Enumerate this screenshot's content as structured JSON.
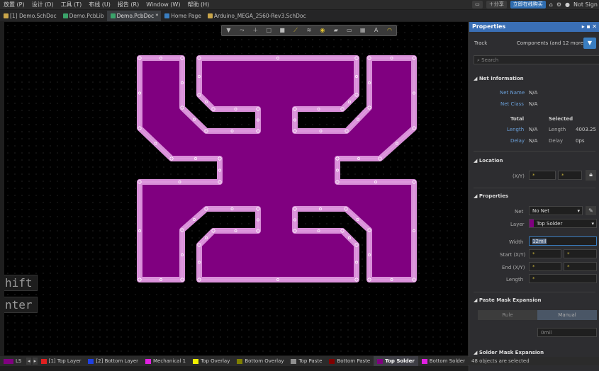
{
  "menu": {
    "items": [
      "放置 (P)",
      "设计 (D)",
      "工具 (T)",
      "布线 (U)",
      "报告 (R)",
      "Window (W)",
      "帮助 (H)"
    ],
    "share_label": "分享",
    "online_buy_label": "立即在线购买",
    "user_label": "Not Sign"
  },
  "tabs": [
    {
      "label": "[1] Demo.SchDoc",
      "icon": "schematic-doc-icon"
    },
    {
      "label": "Demo.PcbLib",
      "icon": "pcb-lib-icon"
    },
    {
      "label": "Demo.PcbDoc *",
      "icon": "pcb-doc-icon"
    },
    {
      "label": "Home Page",
      "icon": "home-icon"
    },
    {
      "label": "Arduino_MEGA_2560-Rev3.SchDoc",
      "icon": "schematic-doc-icon"
    }
  ],
  "canvas": {
    "overlay_hint_1": "hift",
    "overlay_hint_2": "nter",
    "track_color": "#d98fd9",
    "fill_color": "#800080"
  },
  "panel": {
    "title": "Properties",
    "object_type": "Track",
    "filter_summary": "Components (and 12 more)",
    "search_placeholder": "Search",
    "net_info": {
      "title": "Net Information",
      "net_name_label": "Net Name",
      "net_name_value": "N/A",
      "net_class_label": "Net Class",
      "net_class_value": "N/A",
      "total_header": "Total",
      "selected_header": "Selected",
      "length_label": "Length",
      "length_total": "N/A",
      "length_selected_label": "Length",
      "length_selected": "4003.25",
      "delay_label": "Delay",
      "delay_total": "N/A",
      "delay_selected_label": "Delay",
      "delay_selected": "0ps"
    },
    "location": {
      "title": "Location",
      "xy_label": "(X/Y)",
      "x_value": "*",
      "y_value": "*"
    },
    "properties": {
      "title": "Properties",
      "net_label": "Net",
      "net_value": "No Net",
      "layer_label": "Layer",
      "layer_value": "Top Solder",
      "layer_color": "#800080",
      "width_label": "Width",
      "width_value": "12mil",
      "start_label": "Start (X/Y)",
      "start_x": "*",
      "start_y": "*",
      "end_label": "End (X/Y)",
      "end_x": "*",
      "end_y": "*",
      "length_label": "Length",
      "length_value": "*"
    },
    "paste_mask": {
      "title": "Paste Mask Expansion",
      "rule_label": "Rule",
      "manual_label": "Manual",
      "value": "0mil"
    },
    "solder_mask": {
      "title": "Solder Mask Expansion"
    }
  },
  "layers": [
    {
      "label": "LS",
      "color": "#800080"
    },
    {
      "label": "[1] Top Layer",
      "color": "#e02020"
    },
    {
      "label": "[2] Bottom Layer",
      "color": "#2040e0"
    },
    {
      "label": "Mechanical 1",
      "color": "#e020e0"
    },
    {
      "label": "Top Overlay",
      "color": "#f0f000"
    },
    {
      "label": "Bottom Overlay",
      "color": "#808000"
    },
    {
      "label": "Top Paste",
      "color": "#909090"
    },
    {
      "label": "Bottom Paste",
      "color": "#800000"
    },
    {
      "label": "Top Solder",
      "color": "#800080"
    },
    {
      "label": "Bottom Solder",
      "color": "#e020e0"
    }
  ],
  "status": {
    "selection_text": "48 objects are selected"
  }
}
